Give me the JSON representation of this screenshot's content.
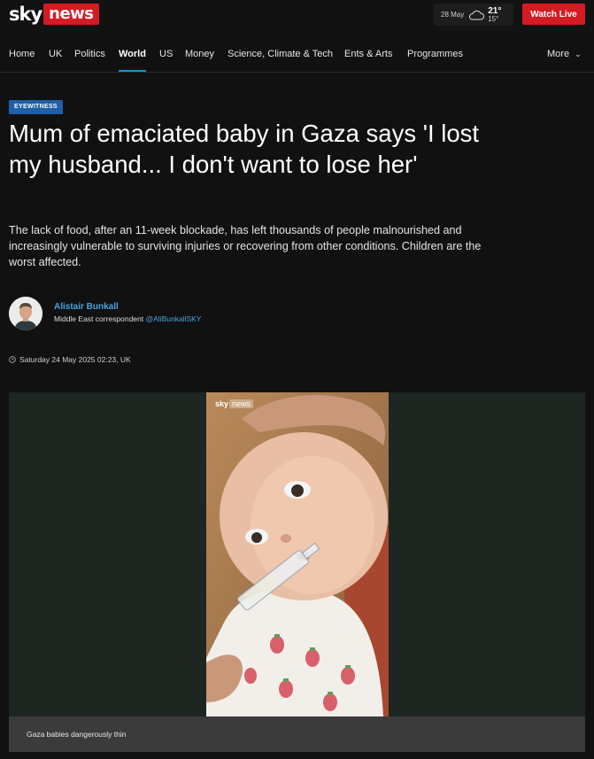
{
  "header": {
    "logo_sky": "sky",
    "logo_news": "news",
    "weather": {
      "date": "28 May",
      "icon": "cloud-icon",
      "high": "21°",
      "low": "15°"
    },
    "watch_live": "Watch Live"
  },
  "nav": {
    "items": [
      {
        "label": "Home"
      },
      {
        "label": "UK"
      },
      {
        "label": "Politics"
      },
      {
        "label": "World",
        "active": true
      },
      {
        "label": "US"
      },
      {
        "label": "Money"
      },
      {
        "label": "Science, Climate & Tech"
      },
      {
        "label": "Ents & Arts"
      },
      {
        "label": "Programmes"
      }
    ],
    "more": "More"
  },
  "article": {
    "tag": "EYEWITNESS",
    "headline": "Mum of emaciated baby in Gaza says 'I lost my husband... I don't want to lose her'",
    "standfirst": "The lack of food, after an 11-week blockade, has left thousands of people malnourished and increasingly vulnerable to surviving injuries or recovering from other conditions. Children are the worst affected.",
    "author": {
      "name": "Alistair Bunkall",
      "role": "Middle East correspondent",
      "handle": "@AliBunkallSKY"
    },
    "timestamp": "Saturday 24 May 2025 02:23, UK"
  },
  "media": {
    "watermark_sky": "sky",
    "watermark_news": "news",
    "caption": "Gaza babies dangerously thin"
  },
  "colors": {
    "background": "#111111",
    "brand_red": "#d41b23",
    "accent_blue": "#1f8ecf",
    "tag_blue": "#1e5fa8"
  }
}
